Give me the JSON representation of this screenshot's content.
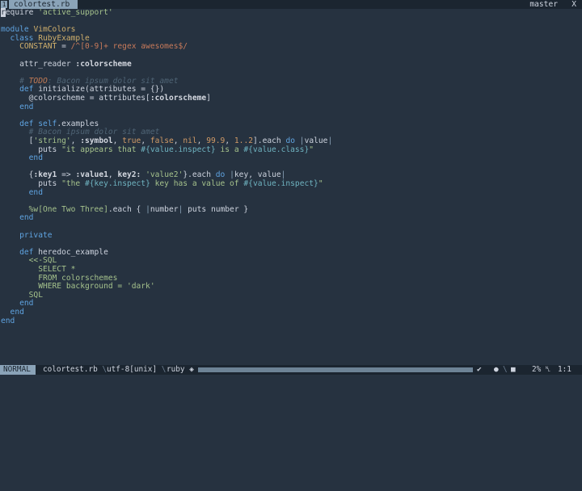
{
  "tabline": {
    "tab_number": "1",
    "tab_name": "colortest.rb",
    "branch": "master",
    "close": "X"
  },
  "editor": {
    "lines": [
      [
        {
          "t": "r",
          "c": "cursor"
        },
        {
          "t": "equire ",
          "c": ""
        },
        {
          "t": "'active_support'",
          "c": "str"
        }
      ],
      [],
      [
        {
          "t": "module ",
          "c": "kw"
        },
        {
          "t": "VimColors",
          "c": "const"
        }
      ],
      [
        {
          "t": "  class ",
          "c": "kw"
        },
        {
          "t": "RubyExample",
          "c": "const"
        }
      ],
      [
        {
          "t": "    CONSTANT",
          "c": "const"
        },
        {
          "t": " = ",
          "c": ""
        },
        {
          "t": "/^[0-9]+ regex awesomes$/",
          "c": "re"
        }
      ],
      [],
      [
        {
          "t": "    attr_reader ",
          "c": ""
        },
        {
          "t": ":colorscheme",
          "c": "sym"
        }
      ],
      [],
      [
        {
          "t": "    # ",
          "c": "cmt"
        },
        {
          "t": "TODO",
          "c": "todo"
        },
        {
          "t": ": Bacon ipsum dolor sit amet",
          "c": "cmt"
        }
      ],
      [
        {
          "t": "    def ",
          "c": "kw"
        },
        {
          "t": "initialize(attributes = {})",
          "c": ""
        }
      ],
      [
        {
          "t": "      @colorscheme = attributes[",
          "c": ""
        },
        {
          "t": ":colorscheme",
          "c": "sym"
        },
        {
          "t": "]",
          "c": ""
        }
      ],
      [
        {
          "t": "    end",
          "c": "kw"
        }
      ],
      [],
      [
        {
          "t": "    def ",
          "c": "kw"
        },
        {
          "t": "self",
          "c": "kw"
        },
        {
          "t": ".examples",
          "c": ""
        }
      ],
      [
        {
          "t": "      # Bacon ipsum dolor sit amet",
          "c": "cmt"
        }
      ],
      [
        {
          "t": "      [",
          "c": ""
        },
        {
          "t": "'string'",
          "c": "str"
        },
        {
          "t": ", ",
          "c": ""
        },
        {
          "t": ":symbol",
          "c": "sym"
        },
        {
          "t": ", ",
          "c": ""
        },
        {
          "t": "true",
          "c": "num"
        },
        {
          "t": ", ",
          "c": ""
        },
        {
          "t": "false",
          "c": "num"
        },
        {
          "t": ", ",
          "c": ""
        },
        {
          "t": "nil",
          "c": "num"
        },
        {
          "t": ", ",
          "c": ""
        },
        {
          "t": "99.9",
          "c": "num"
        },
        {
          "t": ", ",
          "c": ""
        },
        {
          "t": "1..2",
          "c": "num"
        },
        {
          "t": "].each ",
          "c": ""
        },
        {
          "t": "do",
          "c": "kw"
        },
        {
          "t": " |",
          "c": "bar"
        },
        {
          "t": "value",
          "c": ""
        },
        {
          "t": "|",
          "c": "bar"
        }
      ],
      [
        {
          "t": "        puts ",
          "c": ""
        },
        {
          "t": "\"it appears that ",
          "c": "str"
        },
        {
          "t": "#{value.inspect}",
          "c": "interp"
        },
        {
          "t": " is a ",
          "c": "str"
        },
        {
          "t": "#{value.class}",
          "c": "interp"
        },
        {
          "t": "\"",
          "c": "str"
        }
      ],
      [
        {
          "t": "      end",
          "c": "kw"
        }
      ],
      [],
      [
        {
          "t": "      {",
          "c": ""
        },
        {
          "t": ":key1",
          "c": "sym"
        },
        {
          "t": " => ",
          "c": ""
        },
        {
          "t": ":value1",
          "c": "sym"
        },
        {
          "t": ", ",
          "c": ""
        },
        {
          "t": "key2:",
          "c": "sym"
        },
        {
          "t": " ",
          "c": ""
        },
        {
          "t": "'value2'",
          "c": "str"
        },
        {
          "t": "}.each ",
          "c": ""
        },
        {
          "t": "do",
          "c": "kw"
        },
        {
          "t": " |",
          "c": "bar"
        },
        {
          "t": "key, value",
          "c": ""
        },
        {
          "t": "|",
          "c": "bar"
        }
      ],
      [
        {
          "t": "        puts ",
          "c": ""
        },
        {
          "t": "\"the ",
          "c": "str"
        },
        {
          "t": "#{key.inspect}",
          "c": "interp"
        },
        {
          "t": " key has a value of ",
          "c": "str"
        },
        {
          "t": "#{value.inspect}",
          "c": "interp"
        },
        {
          "t": "\"",
          "c": "str"
        }
      ],
      [
        {
          "t": "      end",
          "c": "kw"
        }
      ],
      [],
      [
        {
          "t": "      %w[",
          "c": "str"
        },
        {
          "t": "One Two Three",
          "c": "str"
        },
        {
          "t": "]",
          "c": "str"
        },
        {
          "t": ".each { ",
          "c": ""
        },
        {
          "t": "|",
          "c": "bar"
        },
        {
          "t": "number",
          "c": ""
        },
        {
          "t": "|",
          "c": "bar"
        },
        {
          "t": " puts number }",
          "c": ""
        }
      ],
      [
        {
          "t": "    end",
          "c": "kw"
        }
      ],
      [],
      [
        {
          "t": "    private",
          "c": "kw"
        }
      ],
      [],
      [
        {
          "t": "    def ",
          "c": "kw"
        },
        {
          "t": "heredoc_example",
          "c": ""
        }
      ],
      [
        {
          "t": "      <<-SQL",
          "c": "str"
        }
      ],
      [
        {
          "t": "        SELECT *",
          "c": "str"
        }
      ],
      [
        {
          "t": "        FROM colorschemes",
          "c": "str"
        }
      ],
      [
        {
          "t": "        WHERE background = 'dark'",
          "c": "str"
        }
      ],
      [
        {
          "t": "      SQL",
          "c": "str"
        }
      ],
      [
        {
          "t": "    end",
          "c": "kw"
        }
      ],
      [
        {
          "t": "  end",
          "c": "kw"
        }
      ],
      [
        {
          "t": "end",
          "c": "kw"
        }
      ]
    ]
  },
  "statusline": {
    "mode": "NORMAL",
    "file": "colortest.rb",
    "encoding": "utf-8[unix]",
    "filetype": "ruby",
    "percent": "2%",
    "position": "1:1",
    "sep": "\\"
  },
  "colors": {
    "background": "#263240",
    "statusbar": "#1b2530",
    "accent": "#8aa3b8",
    "string": "#a5c28c",
    "keyword": "#5fa3e0",
    "comment": "#4f6475"
  }
}
